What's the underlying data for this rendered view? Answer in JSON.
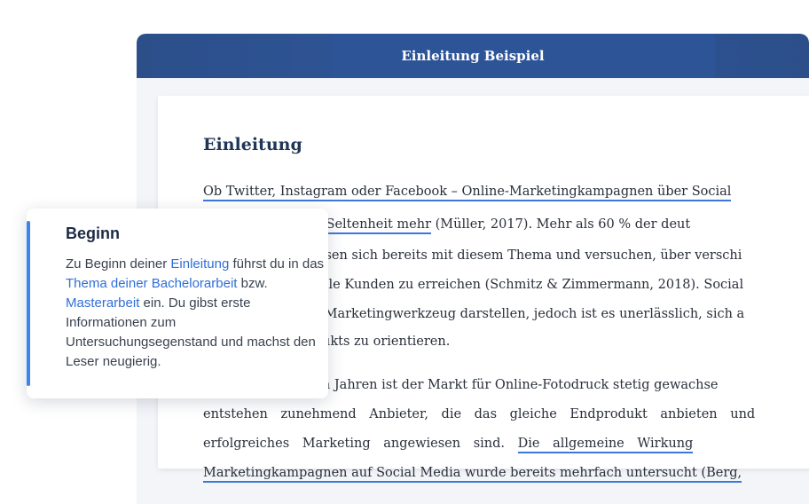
{
  "document": {
    "title": "Einleitung Beispiel",
    "heading": "Einleitung",
    "lines": [
      {
        "parts": [
          {
            "text": "Ob Twitter, Instagram oder Facebook – Online-Marketingkampagnen über Social ",
            "u": true
          }
        ]
      },
      {
        "parts": [
          {
            "text": "ne Seltenheit mehr",
            "u": true
          },
          {
            "text": " (Müller, 2017). Mehr als 60 % der deut",
            "u": false
          }
        ]
      },
      {
        "parts": [
          {
            "text": "fassen sich bereits mit diesem Thema und versuchen, über verschi",
            "u": false
          }
        ]
      },
      {
        "parts": [
          {
            "text": "zielle Kunden zu erreichen (Schmitz & Zimmermann, 2018). Social",
            "u": false
          }
        ]
      },
      {
        "parts": [
          {
            "text": "es Marketingwerkzeug darstellen, jedoch ist es unerlässlich, sich a",
            "u": false
          }
        ]
      },
      {
        "parts": [
          {
            "text": "odukts zu orientieren.",
            "u": false
          }
        ]
      },
      {
        "parts": [
          {
            "text": "ehn Jahren ist der Markt für Online-Fotodruck stetig gewachse",
            "u": false
          }
        ]
      },
      {
        "parts": [
          {
            "text": "entstehen zunehmend Anbieter, die das gleiche Endprodukt anbieten und",
            "u": false
          }
        ]
      },
      {
        "parts": [
          {
            "text": "erfolgreiches Marketing angewiesen sind. ",
            "u": false
          },
          {
            "text": "Die allgemeine Wirkung",
            "u": true
          }
        ]
      },
      {
        "parts": [
          {
            "text": "Marketingkampagnen auf Social Media wurde bereits mehrfach untersucht (Berg,",
            "u": true
          }
        ]
      }
    ]
  },
  "tooltip": {
    "title": "Beginn",
    "segments": [
      {
        "text": "Zu Beginn deiner ",
        "link": false
      },
      {
        "text": "Einleitung",
        "link": true
      },
      {
        "text": " führst du in das ",
        "link": false
      },
      {
        "text": "Thema deiner Bachelorarbeit",
        "link": true
      },
      {
        "text": " bzw. ",
        "link": false
      },
      {
        "text": "Masterarbeit",
        "link": true
      },
      {
        "text": " ein. Du gibst erste Informationen zum Untersuchungsegenstand und machst den Leser neugierig.",
        "link": false
      }
    ]
  },
  "colors": {
    "header": "#2e5498",
    "accent": "#3b82f6",
    "link": "#2f6fd6",
    "underline": "#3b78d8"
  }
}
